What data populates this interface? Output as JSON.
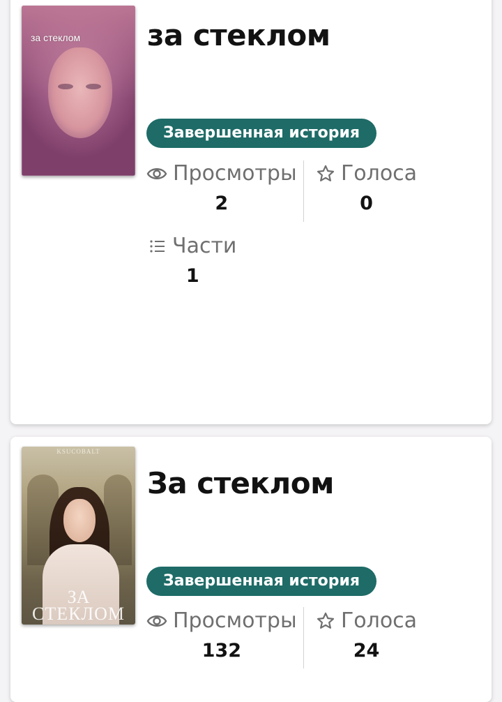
{
  "stories": [
    {
      "cover_text": "за стеклом",
      "title": "за стеклом",
      "badge": "Завершенная история",
      "stats": {
        "views_label": "Просмотры",
        "views_value": "2",
        "votes_label": "Голоса",
        "votes_value": "0",
        "parts_label": "Части",
        "parts_value": "1"
      }
    },
    {
      "cover_author": "KSUCOBALT",
      "cover_title_line1": "ЗА",
      "cover_title_line2": "СТЕКЛОМ",
      "title": "За стеклом",
      "badge": "Завершенная история",
      "stats": {
        "views_label": "Просмотры",
        "views_value": "132",
        "votes_label": "Голоса",
        "votes_value": "24"
      }
    }
  ],
  "colors": {
    "badge_bg": "#1e6b67",
    "text": "#121212",
    "label": "#6f6f6f"
  },
  "icons": {
    "views": "eye-icon",
    "votes": "star-outline-icon",
    "parts": "list-icon"
  }
}
